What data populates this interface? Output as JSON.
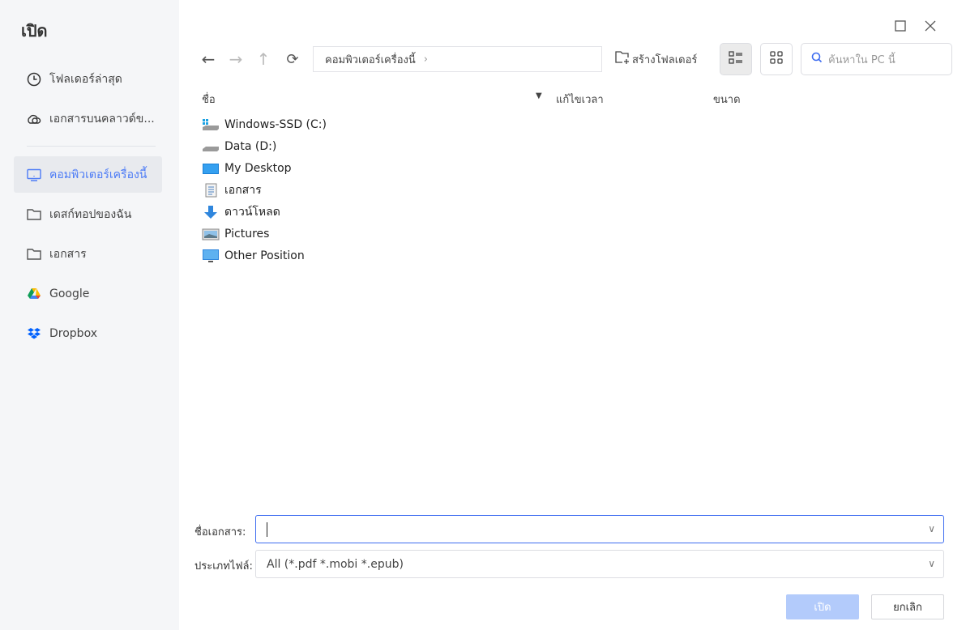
{
  "dialog": {
    "title": "เปิด"
  },
  "sidebar": {
    "items": [
      {
        "label": "โฟลเดอร์ล่าสุด",
        "icon": "clock-icon"
      },
      {
        "label": "เอกสารบนคลาวด์ข...",
        "icon": "cloud-icon"
      },
      {
        "label": "คอมพิวเตอร์เครื่องนี้",
        "icon": "monitor-icon",
        "active": true
      },
      {
        "label": "เดสก์ทอปของฉัน",
        "icon": "folder-icon"
      },
      {
        "label": "เอกสาร",
        "icon": "folder-icon"
      },
      {
        "label": "Google",
        "icon": "google-drive-icon"
      },
      {
        "label": "Dropbox",
        "icon": "dropbox-icon"
      }
    ]
  },
  "toolbar": {
    "breadcrumb": "คอมพิวเตอร์เครื่องนี้",
    "new_folder": "สร้างโฟลเดอร์",
    "search_placeholder": "ค้นหาใน PC นี้"
  },
  "columns": {
    "name": "ชื่อ",
    "modified": "แก้ไขเวลา",
    "size": "ขนาด"
  },
  "files": [
    {
      "name": "Windows-SSD (C:)",
      "icon": "windows-drive-icon"
    },
    {
      "name": "Data (D:)",
      "icon": "drive-icon"
    },
    {
      "name": "My Desktop",
      "icon": "desktop-icon"
    },
    {
      "name": "เอกสาร",
      "icon": "document-icon"
    },
    {
      "name": "ดาวน์โหลด",
      "icon": "download-icon"
    },
    {
      "name": "Pictures",
      "icon": "pictures-icon"
    },
    {
      "name": "Other Position",
      "icon": "monitor-icon"
    }
  ],
  "footer": {
    "filename_label": "ชื่อเอกสาร:",
    "filename_value": "",
    "filetype_label": "ประเภทไฟล์:",
    "filetype_value": "All (*.pdf *.mobi *.epub)",
    "open": "เปิด",
    "cancel": "ยกเลิก"
  },
  "colors": {
    "accent": "#4d7cf6",
    "disabled_button": "#b3cbfb"
  }
}
